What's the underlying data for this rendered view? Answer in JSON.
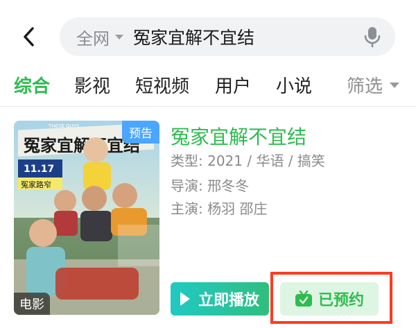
{
  "search": {
    "scope": "全网",
    "query": "冤家宜解不宜结"
  },
  "tabs": [
    {
      "label": "综合",
      "active": true
    },
    {
      "label": "影视"
    },
    {
      "label": "短视频"
    },
    {
      "label": "用户"
    },
    {
      "label": "小说"
    }
  ],
  "filter": {
    "label": "筛选"
  },
  "result": {
    "title": "冤家宜解不宜结",
    "badge": "预告",
    "media_type": "电影",
    "genre_line": "类型: 2021 / 华语 / 搞笑",
    "director_line": "导演: 邢冬冬",
    "cast_line": "主演: 杨羽   邵庄",
    "poster_text": {
      "title_art": "冤家宜解不宜结",
      "date": "11.17",
      "subtitle": "冤家路窄",
      "top_small": "THESE GUYS"
    },
    "play_button": "立即播放",
    "reserved_button": "已预约"
  },
  "colors": {
    "accent": "#2fbb4f",
    "badge": "#4aa6ff",
    "highlight": "#ff3b1f"
  },
  "icons": [
    "back-icon",
    "dropdown-arrow-icon",
    "mic-icon",
    "play-icon",
    "tv-check-icon"
  ]
}
